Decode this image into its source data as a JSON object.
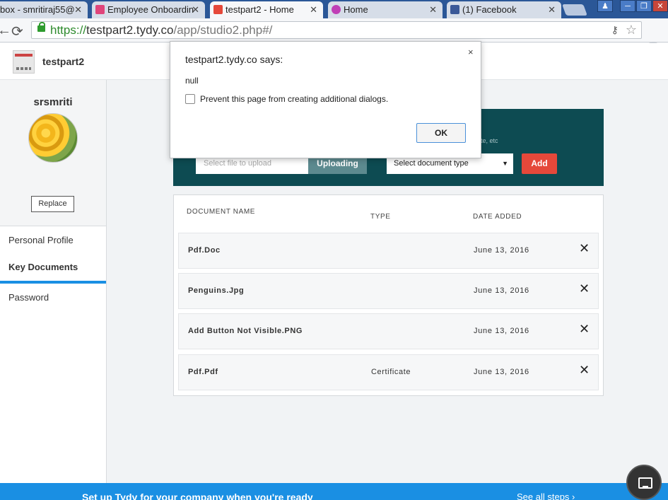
{
  "browser": {
    "tabs": [
      {
        "title": "box - smritiraj55@",
        "favicon_color": "#d14836"
      },
      {
        "title": "Employee Onboardin",
        "favicon_color": "#e0457b"
      },
      {
        "title": "testpart2 - Home",
        "favicon_color": "#e5483a"
      },
      {
        "title": "Home",
        "favicon_color": "#c03fb6"
      },
      {
        "title": "(1) Facebook",
        "favicon_color": "#3b5998"
      }
    ],
    "url_scheme": "https://",
    "url_host": "testpart2.tydy.co",
    "url_path": "/app/studio2.php#/",
    "window_buttons": [
      "─",
      "❐",
      "✕"
    ]
  },
  "app": {
    "name": "testpart2"
  },
  "sidebar": {
    "username": "srsmriti",
    "replace_label": "Replace",
    "menu": [
      {
        "label": "Personal Profile"
      },
      {
        "label": "Key Documents"
      },
      {
        "label": "Password"
      }
    ]
  },
  "upload": {
    "hint_text": "ate, etc",
    "file_placeholder": "Select file to upload",
    "upload_label": "Uploading",
    "doctype_label": "Select document type",
    "add_label": "Add"
  },
  "documents": {
    "headers": {
      "name": "DOCUMENT NAME",
      "type": "TYPE",
      "date": "DATE ADDED"
    },
    "rows": [
      {
        "name": "Pdf.Doc",
        "type": "",
        "date": "June 13, 2016"
      },
      {
        "name": "Penguins.Jpg",
        "type": "",
        "date": "June 13, 2016"
      },
      {
        "name": "Add Button Not Visible.PNG",
        "type": "",
        "date": "June 13, 2016"
      },
      {
        "name": "Pdf.Pdf",
        "type": "Certificate",
        "date": "June 13, 2016"
      }
    ]
  },
  "bottom_bar": {
    "text": "Set up Tydy for your company when you're ready",
    "see_all": "See all steps ›"
  },
  "dialog": {
    "title": "testpart2.tydy.co says:",
    "message": "null",
    "checkbox_label": "Prevent this page from creating additional dialogs.",
    "ok_label": "OK",
    "close_glyph": "×"
  },
  "colors": {
    "panel": "#0d4b52",
    "accent_blue": "#1a8fe3",
    "add_red": "#e5483a",
    "tab_strip": "#2b5797"
  }
}
